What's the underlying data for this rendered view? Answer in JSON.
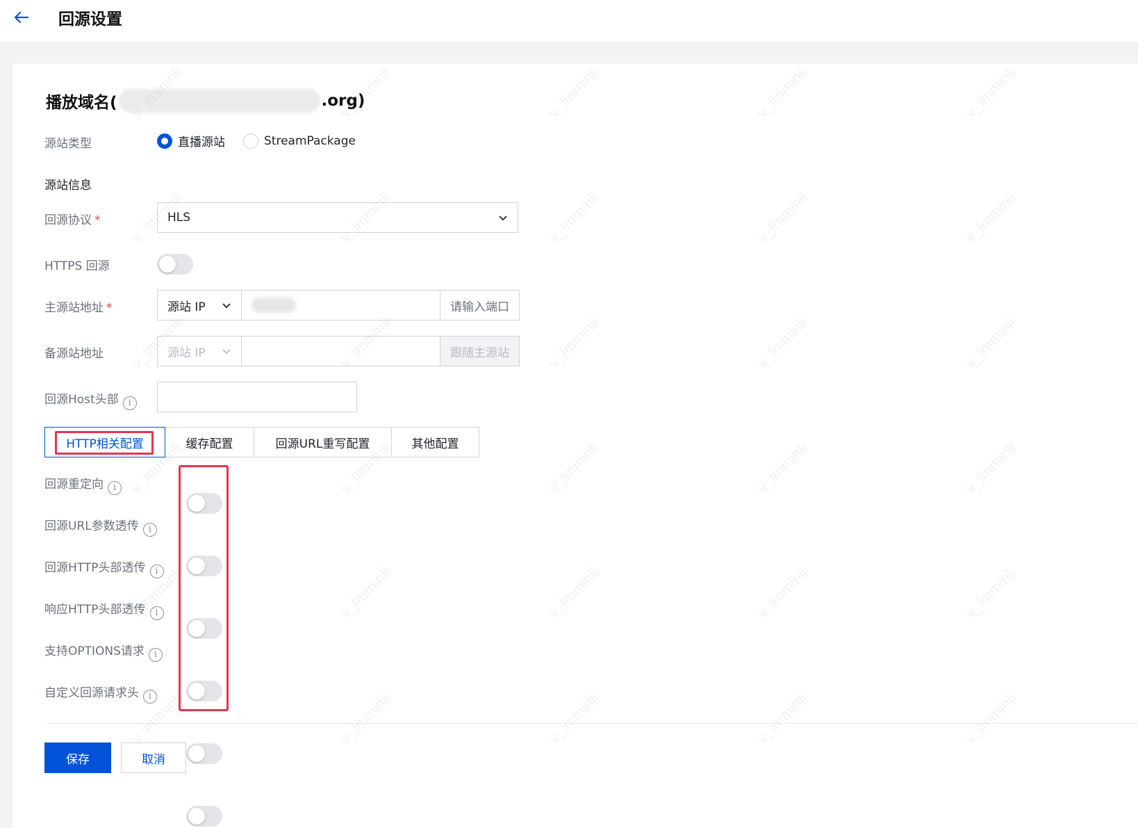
{
  "header": {
    "title": "回源设置",
    "back_icon": "arrow-left-icon"
  },
  "domain": {
    "prefix": "播放域名(",
    "suffix": ".org)"
  },
  "origin_type": {
    "label": "源站类型",
    "options": [
      {
        "label": "直播源站",
        "checked": true
      },
      {
        "label": "StreamPackage",
        "checked": false
      }
    ]
  },
  "origin_info": {
    "heading": "源站信息"
  },
  "protocol": {
    "label": "回源协议",
    "required_mark": "*",
    "value": "HLS"
  },
  "https": {
    "label": "HTTPS 回源",
    "on": false
  },
  "primary_addr": {
    "label": "主源站地址",
    "required_mark": "*",
    "type": "源站 IP",
    "port_placeholder": "请输入端口"
  },
  "backup_addr": {
    "label": "备源站地址",
    "type": "源站 IP",
    "port_text": "跟随主源站"
  },
  "host_header": {
    "label": "回源Host头部",
    "value": ""
  },
  "tabs": [
    {
      "label": "HTTP相关配置",
      "active": true
    },
    {
      "label": "缓存配置",
      "active": false
    },
    {
      "label": "回源URL重写配置",
      "active": false
    },
    {
      "label": "其他配置",
      "active": false
    }
  ],
  "http_settings": [
    {
      "label": "回源重定向",
      "on": false
    },
    {
      "label": "回源URL参数透传",
      "on": false
    },
    {
      "label": "回源HTTP头部透传",
      "on": false
    },
    {
      "label": "响应HTTP头部透传",
      "on": false
    },
    {
      "label": "支持OPTIONS请求",
      "on": false
    },
    {
      "label": "自定义回源请求头",
      "on": false
    }
  ],
  "info_glyph": "i",
  "footer": {
    "save_label": "保存",
    "cancel_label": "取消"
  },
  "watermark_text": "v_lmminli",
  "colors": {
    "primary": "#0052d9",
    "highlight": "#e2364f",
    "required": "#e54545"
  }
}
